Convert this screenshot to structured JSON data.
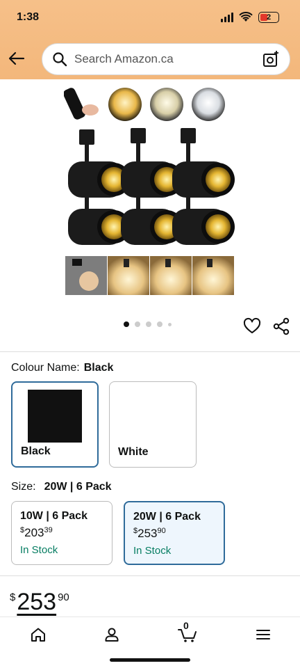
{
  "status_bar": {
    "time": "1:38",
    "battery": "2"
  },
  "search": {
    "placeholder": "Search Amazon.ca"
  },
  "product": {
    "carousel_dots": 5,
    "carousel_active": 0
  },
  "colour": {
    "label": "Colour Name:",
    "selected": "Black",
    "options": [
      {
        "name": "Black",
        "swatch": "#111111",
        "selected": true
      },
      {
        "name": "White",
        "swatch": "#ffffff",
        "selected": false
      }
    ]
  },
  "size": {
    "label": "Size:",
    "selected": "20W | 6 Pack",
    "options": [
      {
        "title": "10W | 6 Pack",
        "currency": "$",
        "whole": "203",
        "fraction": "39",
        "stock": "In Stock",
        "selected": false
      },
      {
        "title": "20W | 6 Pack",
        "currency": "$",
        "whole": "253",
        "fraction": "90",
        "stock": "In Stock",
        "selected": true
      }
    ]
  },
  "price": {
    "currency": "$",
    "whole": "253",
    "fraction": "90"
  },
  "nav": {
    "cart_count": "0"
  },
  "colors": {
    "header": "#f3b77b",
    "selected_border": "#2f6b9a",
    "in_stock": "#067d62"
  }
}
